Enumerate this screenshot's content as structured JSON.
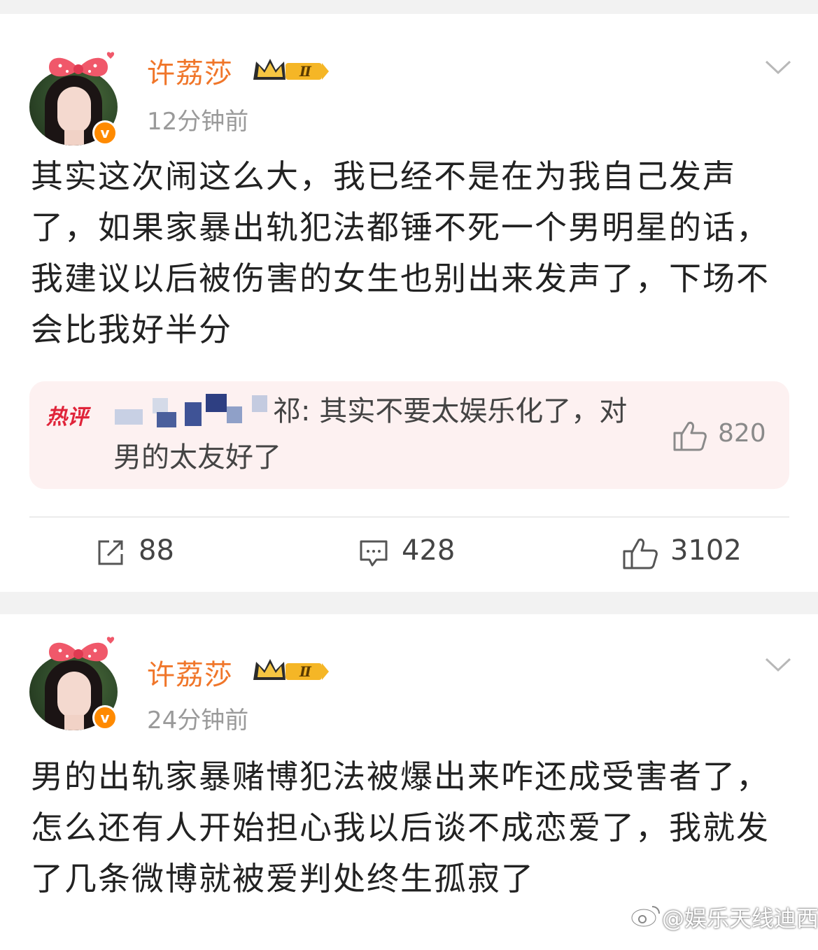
{
  "posts": [
    {
      "user": {
        "name": "许荔莎",
        "level": "Ⅱ"
      },
      "time": "12分钟前",
      "text": "其实这次闹这么大，我已经不是在为我自己发声了，如果家暴出轨犯法都锤不死一个男明星的话，我建议以后被伤害的女生也别出来发声了，下场不会比我好半分",
      "hot_comment": {
        "tag": "热评",
        "author_suffix": "祁",
        "text": ": 其实不要太娱乐化了，对男的太友好了",
        "likes": "820"
      },
      "actions": {
        "reposts": "88",
        "comments": "428",
        "likes": "3102"
      }
    },
    {
      "user": {
        "name": "许荔莎",
        "level": "Ⅱ"
      },
      "time": "24分钟前",
      "text": "男的出轨家暴赌博犯法被爆出来咋还成受害者了，怎么还有人开始担心我以后谈不成恋爱了，我就发了几条微博就被爱判处终生孤寂了"
    }
  ],
  "watermark": "@娱乐天线迪西",
  "colors": {
    "name": "#f0762a",
    "accent": "#ff8a00",
    "hot": "#e0243a"
  }
}
